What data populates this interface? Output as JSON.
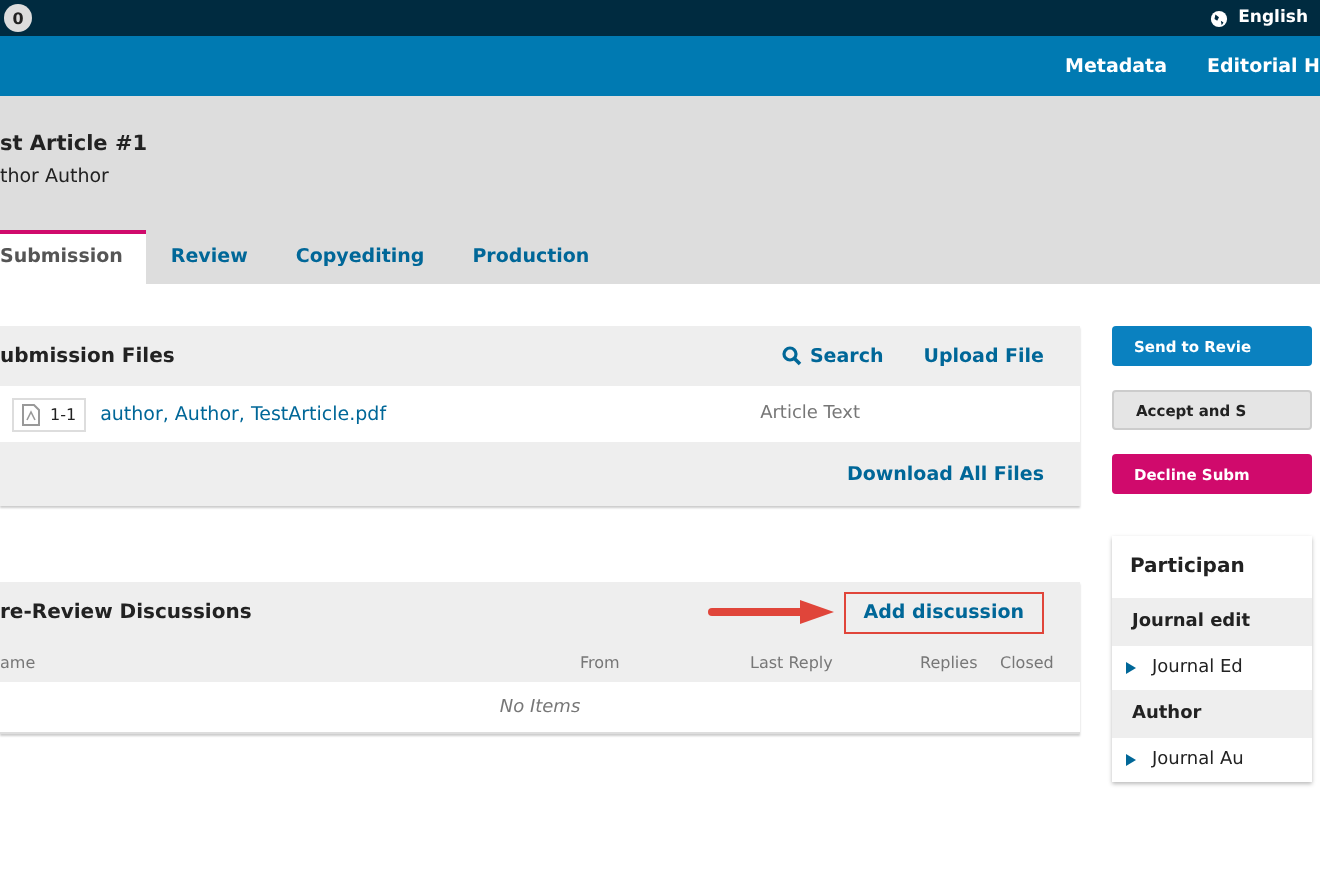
{
  "top_bar": {
    "badge": "0",
    "language": "English"
  },
  "nav": {
    "items": [
      "Metadata",
      "Editorial H"
    ]
  },
  "header": {
    "title": "st Article #1",
    "author": "thor Author"
  },
  "tabs": [
    {
      "label": "Submission",
      "selected": true
    },
    {
      "label": "Review",
      "selected": false
    },
    {
      "label": "Copyediting",
      "selected": false
    },
    {
      "label": "Production",
      "selected": false
    }
  ],
  "files_panel": {
    "title": "ubmission Files",
    "actions": [
      "Search",
      "Upload File"
    ],
    "files": [
      {
        "number": "1-1",
        "name": "author, Author, TestArticle.pdf",
        "type": "Article Text"
      }
    ],
    "footer_action": "Download All Files"
  },
  "discussions_panel": {
    "title": "re-Review Discussions",
    "action": {
      "label": "Add discussion",
      "highlighted": true
    },
    "columns": [
      "ame",
      "From",
      "Last Reply",
      "Replies",
      "Closed"
    ],
    "empty": "No Items"
  },
  "sidebar": {
    "buttons": [
      {
        "label": "Send to Revie",
        "kind": "primary"
      },
      {
        "label": "Accept and S",
        "kind": "default"
      },
      {
        "label": "Decline Subm",
        "kind": "danger"
      }
    ],
    "participants": {
      "title": "Participan",
      "groups": [
        {
          "name": "Journal edit",
          "members": [
            "Journal Ed"
          ]
        },
        {
          "name": "Author",
          "members": [
            "Journal Au"
          ]
        }
      ]
    }
  }
}
